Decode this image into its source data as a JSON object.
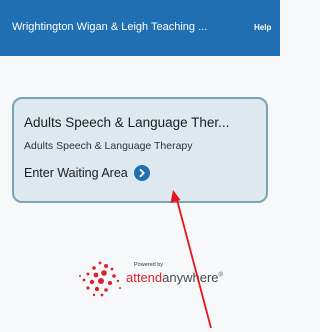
{
  "header": {
    "title": "Wrightington Wigan & Leigh Teaching ...",
    "help_label": "Help"
  },
  "clinic_card": {
    "heading": "Adults Speech & Language Ther...",
    "subtitle": "Adults Speech & Language Therapy",
    "enter_label": "Enter Waiting Area"
  },
  "footer_logo": {
    "powered_by": "Powered by",
    "brand_part1": "attend",
    "brand_part2": "anywhere",
    "brand_mark": "®"
  },
  "colors": {
    "header_bg": "#1f6fb2",
    "card_bg": "#dde9ee",
    "card_border": "#7aa4b4",
    "accent_red": "#d8232a",
    "annotation_arrow": "#e8141b"
  },
  "icons": {
    "enter_icon": "chevron-right-circle-icon",
    "logo_icon": "attend-anywhere-splash-icon"
  }
}
